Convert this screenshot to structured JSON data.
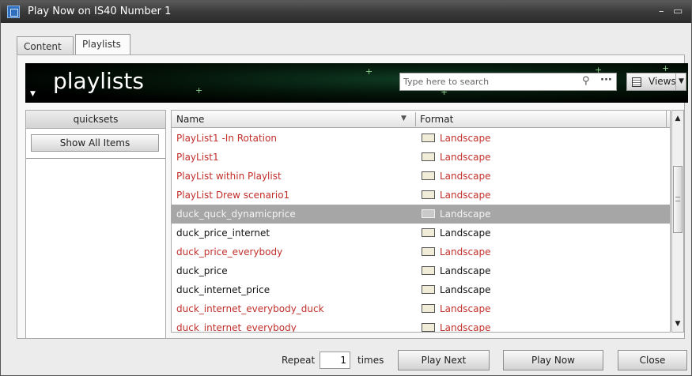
{
  "window": {
    "title": "Play Now on IS40 Number 1"
  },
  "tabs": [
    {
      "label": "Content"
    },
    {
      "label": "Playlists"
    }
  ],
  "banner": {
    "heading": "playlists",
    "search_placeholder": "Type here to search",
    "views_label": "Views"
  },
  "quicksets": {
    "header": "quicksets",
    "show_all_label": "Show All Items"
  },
  "list": {
    "columns": {
      "name": "Name",
      "format": "Format"
    },
    "rows": [
      {
        "name": "PlayList1 -In Rotation",
        "format": "Landscape"
      },
      {
        "name": "PlayList1",
        "format": "Landscape"
      },
      {
        "name": "PlayList within Playlist",
        "format": "Landscape"
      },
      {
        "name": "PlayList Drew scenario1",
        "format": "Landscape"
      },
      {
        "name": "duck_quck_dynamicprice",
        "format": "Landscape"
      },
      {
        "name": "duck_price_internet",
        "format": "Landscape"
      },
      {
        "name": "duck_price_everybody",
        "format": "Landscape"
      },
      {
        "name": "duck_price",
        "format": "Landscape"
      },
      {
        "name": "duck_internet_price",
        "format": "Landscape"
      },
      {
        "name": "duck_internet_everybody_duck",
        "format": "Landscape"
      },
      {
        "name": "duck_internet_everybody",
        "format": "Landscape"
      }
    ]
  },
  "footer": {
    "repeat_label": "Repeat",
    "repeat_value": "1",
    "times_label": "times",
    "play_next_label": "Play Next",
    "play_now_label": "Play Now",
    "close_label": "Close"
  },
  "colors": {
    "red_text": "#c0302b",
    "selected_row": "#a6a6a6",
    "banner_bg": "#041509"
  }
}
